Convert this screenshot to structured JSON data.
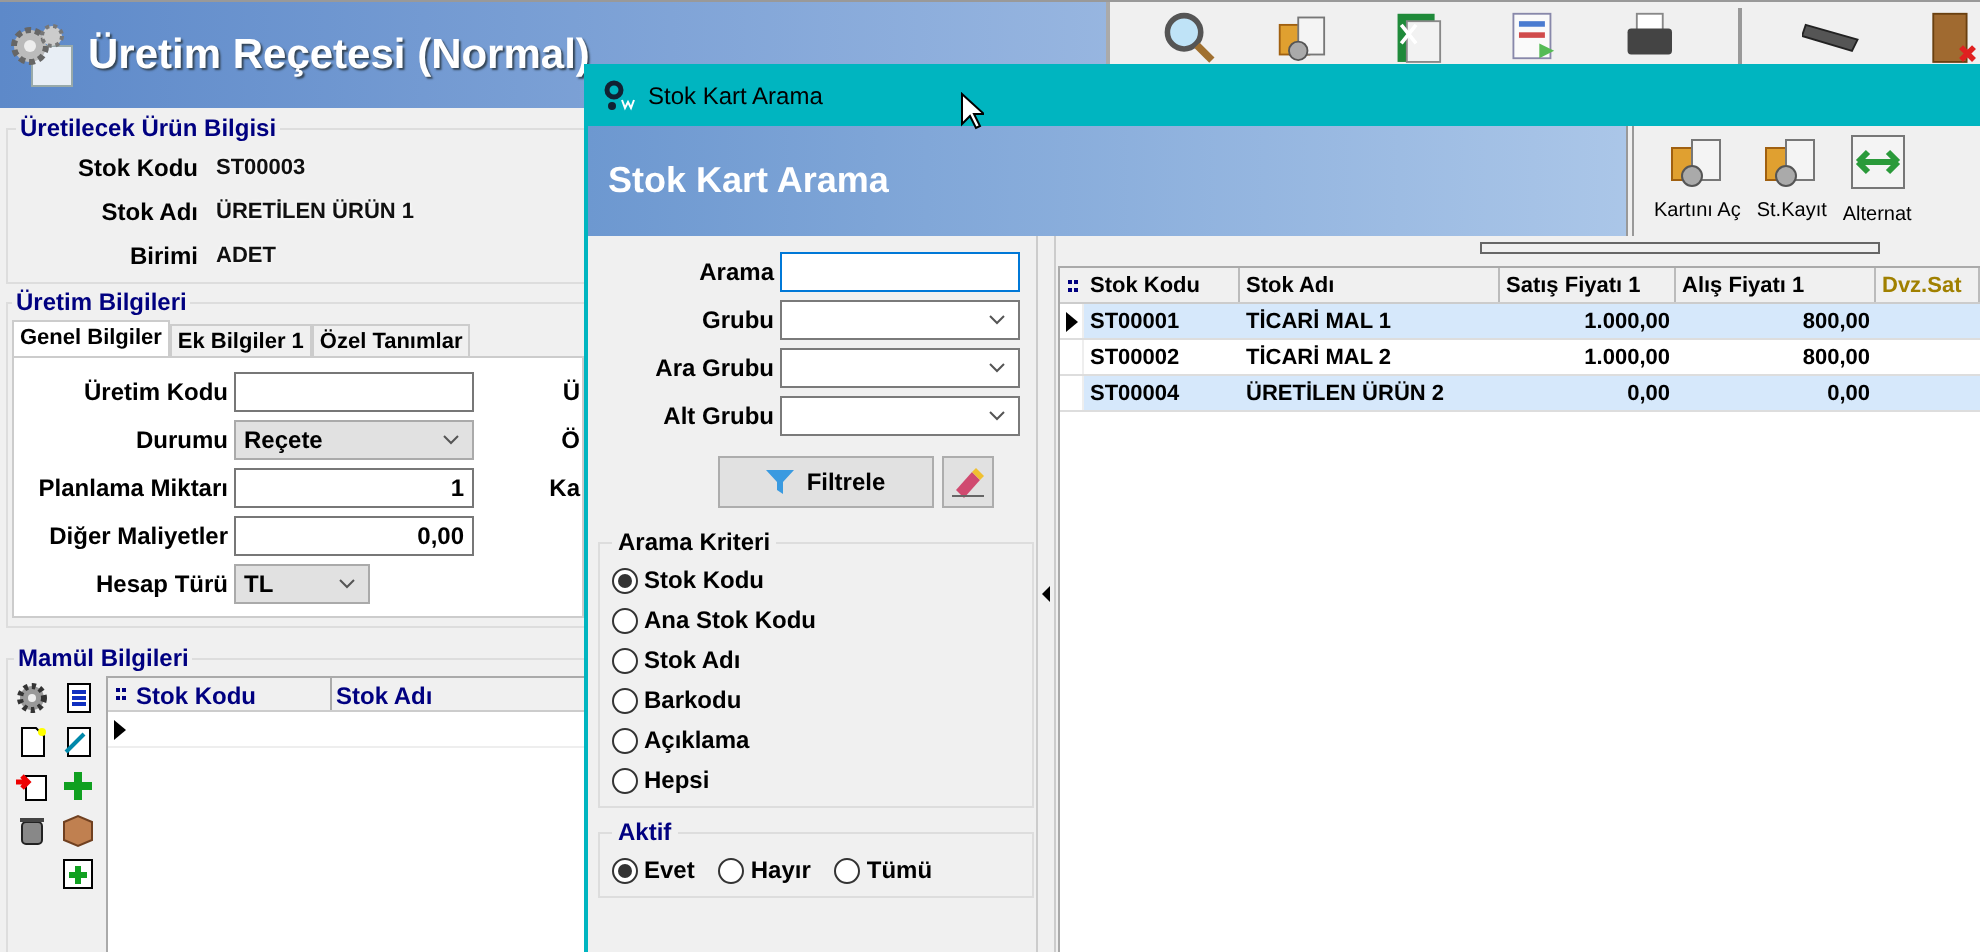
{
  "main_window": {
    "title": "Üretim Reçetesi (Normal)",
    "product_info": {
      "legend": "Üretilecek Ürün Bilgisi",
      "fields": [
        {
          "label": "Stok Kodu",
          "value": "ST00003"
        },
        {
          "label": "Stok Adı",
          "value": "ÜRETİLEN ÜRÜN 1"
        },
        {
          "label": "Birimi",
          "value": "ADET"
        }
      ]
    },
    "production_info": {
      "legend": "Üretim Bilgileri",
      "tabs": [
        {
          "label": "Genel Bilgiler",
          "selected": true
        },
        {
          "label": "Ek Bilgiler 1",
          "selected": false
        },
        {
          "label": "Özel Tanımlar",
          "selected": false
        }
      ],
      "fields": [
        {
          "label": "Üretim Kodu",
          "kind": "text"
        },
        {
          "label": "Durumu",
          "kind": "combo",
          "value": "Reçete"
        },
        {
          "label": "Planlama Miktarı",
          "kind": "number",
          "value": "1"
        },
        {
          "label": "Diğer Maliyetler",
          "kind": "number",
          "value": "0,00"
        },
        {
          "label": "Hesap Türü",
          "kind": "short_combo",
          "value": "TL"
        }
      ],
      "second_column_labels": [
        "Ü",
        "Ö",
        "Ka"
      ]
    },
    "product_details": {
      "legend": "Mamül Bilgileri",
      "columns": [
        "Stok Kodu",
        "Stok Adı"
      ]
    }
  },
  "dialog": {
    "window_title": "Stok Kart Arama",
    "title": "Stok Kart Arama",
    "toolbar": [
      {
        "label": "Kartını Aç",
        "kind": "card"
      },
      {
        "label": "St.Kayıt",
        "kind": "card"
      },
      {
        "label": "Alternat",
        "kind": "swap"
      }
    ],
    "filters": [
      {
        "label": "Arama",
        "kind": "text",
        "focused": true
      },
      {
        "label": "Grubu",
        "kind": "combo",
        "focused": false
      },
      {
        "label": "Ara Grubu",
        "kind": "combo",
        "focused": false
      },
      {
        "label": "Alt Grubu",
        "kind": "combo",
        "focused": false
      }
    ],
    "filter_button": "Filtrele",
    "criteria": {
      "legend": "Arama Kriteri",
      "options": [
        {
          "label": "Stok Kodu",
          "selected": true
        },
        {
          "label": "Ana Stok Kodu",
          "selected": false
        },
        {
          "label": "Stok Adı",
          "selected": false
        },
        {
          "label": "Barkodu",
          "selected": false
        },
        {
          "label": "Açıklama",
          "selected": false
        },
        {
          "label": "Hepsi",
          "selected": false
        }
      ]
    },
    "active": {
      "legend": "Aktif",
      "options": [
        {
          "label": "Evet",
          "selected": true
        },
        {
          "label": "Hayır",
          "selected": false
        },
        {
          "label": "Tümü",
          "selected": false
        }
      ]
    },
    "table": {
      "columns": [
        {
          "label": "Stok Kodu",
          "kind": "text"
        },
        {
          "label": "Stok Adı",
          "kind": "text"
        },
        {
          "label": "Satış Fiyatı 1",
          "kind": "number"
        },
        {
          "label": "Alış Fiyatı 1",
          "kind": "number"
        },
        {
          "label": "Dvz.Sat",
          "kind": "currency"
        }
      ],
      "rows": [
        {
          "selected": true,
          "cells": [
            "ST00001",
            "TİCARİ MAL 1",
            "1.000,00",
            "800,00"
          ]
        },
        {
          "selected": false,
          "cells": [
            "ST00002",
            "TİCARİ MAL 2",
            "1.000,00",
            "800,00"
          ]
        },
        {
          "selected": false,
          "cells": [
            "ST00004",
            "ÜRETİLEN ÜRÜN 2",
            "0,00",
            "0,00"
          ]
        }
      ]
    }
  }
}
